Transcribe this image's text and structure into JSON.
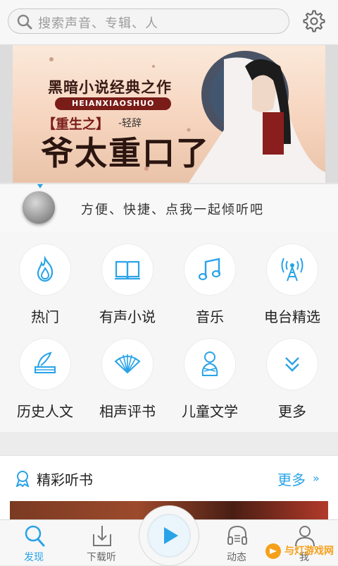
{
  "search": {
    "placeholder": "搜索声音、专辑、人",
    "search_icon": "search-icon",
    "settings_icon": "gear-icon"
  },
  "banner": {
    "title": "黑暗小说经典之作",
    "pill": "HEIANXIAOSHUO",
    "subtitle": "【重生之】",
    "author": "-轻辞",
    "big_title": "爷太重口了"
  },
  "player": {
    "hint": "方便、快捷、点我一起倾听吧"
  },
  "categories": [
    {
      "label": "热门",
      "icon": "flame-icon"
    },
    {
      "label": "有声小说",
      "icon": "book-icon"
    },
    {
      "label": "音乐",
      "icon": "music-note-icon"
    },
    {
      "label": "电台精选",
      "icon": "radio-tower-icon"
    },
    {
      "label": "历史人文",
      "icon": "scroll-quill-icon"
    },
    {
      "label": "相声评书",
      "icon": "fan-icon"
    },
    {
      "label": "儿童文学",
      "icon": "baby-icon"
    },
    {
      "label": "更多",
      "icon": "chevron-down-icon"
    }
  ],
  "section": {
    "title": "精彩听书",
    "more": "更多",
    "more_arrow": "»"
  },
  "tabs": [
    {
      "label": "发现",
      "icon": "discover-search-icon",
      "active": true
    },
    {
      "label": "下载听",
      "icon": "download-icon",
      "active": false
    },
    {
      "label": "动态",
      "icon": "headset-icon",
      "active": false
    },
    {
      "label": "我",
      "icon": "user-icon",
      "active": false
    }
  ],
  "watermark": {
    "text": "与灯游戏网"
  },
  "colors": {
    "accent": "#29a3e8",
    "banner_pill": "#7a1d18"
  }
}
